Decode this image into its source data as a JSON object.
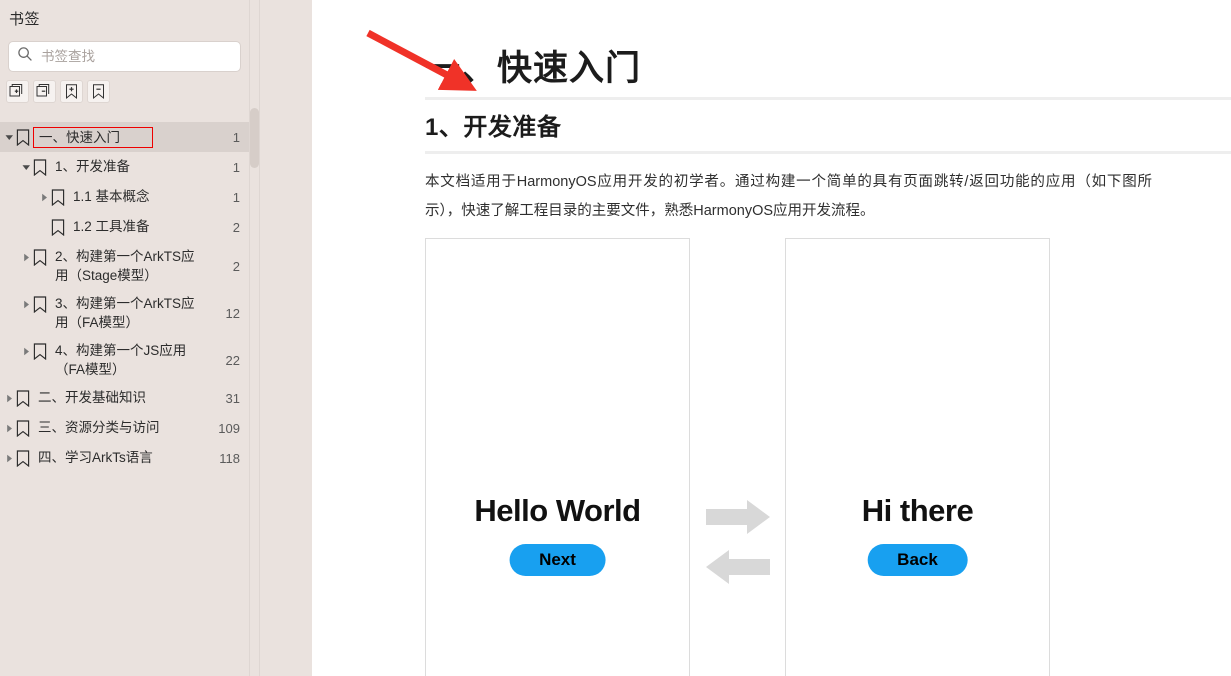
{
  "sidebar": {
    "title": "书签",
    "close_icon": "close-icon",
    "search": {
      "placeholder": "书签查找",
      "value": "",
      "icon": "search-icon"
    },
    "toolbar": [
      {
        "name": "expand-all-button",
        "icon": "document-plus-icon",
        "tooltip": "展开全部"
      },
      {
        "name": "collapse-all-button",
        "icon": "document-minus-icon",
        "tooltip": "收起全部"
      },
      {
        "name": "add-bookmark-button",
        "icon": "bookmark-plus-icon",
        "tooltip": "添加书签"
      },
      {
        "name": "remove-bookmark-button",
        "icon": "bookmark-minus-icon",
        "tooltip": "删除书签"
      }
    ],
    "tree": [
      {
        "label": "一、快速入门",
        "page": "1",
        "indent": 0,
        "expanded": true,
        "has_children": true,
        "selected": true,
        "highlighted": true
      },
      {
        "label": "1、开发准备",
        "page": "1",
        "indent": 1,
        "expanded": true,
        "has_children": true,
        "selected": false,
        "highlighted": false
      },
      {
        "label": "1.1 基本概念",
        "page": "1",
        "indent": 2,
        "expanded": false,
        "has_children": true,
        "selected": false,
        "highlighted": false
      },
      {
        "label": "1.2 工具准备",
        "page": "2",
        "indent": 2,
        "expanded": false,
        "has_children": false,
        "selected": false,
        "highlighted": false
      },
      {
        "label": "2、构建第一个ArkTS应用（Stage模型）",
        "page": "2",
        "indent": 1,
        "expanded": false,
        "has_children": true,
        "selected": false,
        "highlighted": false
      },
      {
        "label": "3、构建第一个ArkTS应用（FA模型）",
        "page": "12",
        "indent": 1,
        "expanded": false,
        "has_children": true,
        "selected": false,
        "highlighted": false
      },
      {
        "label": "4、构建第一个JS应用（FA模型）",
        "page": "22",
        "indent": 1,
        "expanded": false,
        "has_children": true,
        "selected": false,
        "highlighted": false
      },
      {
        "label": "二、开发基础知识",
        "page": "31",
        "indent": 0,
        "expanded": false,
        "has_children": true,
        "selected": false,
        "highlighted": false
      },
      {
        "label": "三、资源分类与访问",
        "page": "109",
        "indent": 0,
        "expanded": false,
        "has_children": true,
        "selected": false,
        "highlighted": false
      },
      {
        "label": "四、学习ArkTs语言",
        "page": "118",
        "indent": 0,
        "expanded": false,
        "has_children": true,
        "selected": false,
        "highlighted": false
      }
    ]
  },
  "document": {
    "heading1": "一、快速入门",
    "heading2": "1、开发准备",
    "paragraph": "本文档适用于HarmonyOS应用开发的初学者。通过构建一个简单的具有页面跳转/返回功能的应用（如下图所示），快速了解工程目录的主要文件，熟悉HarmonyOS应用开发流程。",
    "figure": {
      "left_phone": {
        "screen_text": "Hello World",
        "button_label": "Next"
      },
      "right_phone": {
        "screen_text": "Hi there",
        "button_label": "Back"
      },
      "arrow_right_icon": "arrow-right-icon",
      "arrow_left_icon": "arrow-left-icon"
    }
  },
  "annotation": {
    "arrow_color": "#f03228",
    "highlight_box_color": "#ee0000"
  },
  "colors": {
    "sidebar_bg": "#eae2de",
    "sidebar_selected": "#d9d1cd",
    "doc_bg": "#ffffff",
    "button_blue": "#18a0f0",
    "heading_rule": "#eeeeee",
    "arrow_gray": "#d8d8d8"
  }
}
